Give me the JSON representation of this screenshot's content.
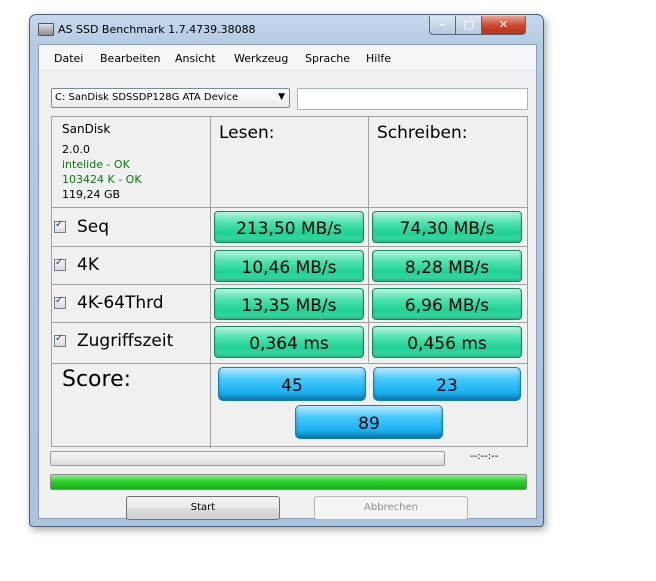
{
  "window": {
    "title": "AS SSD Benchmark 1.7.4739.38088"
  },
  "menu": [
    "Datei",
    "Bearbeiten",
    "Ansicht",
    "Werkzeug",
    "Sprache",
    "Hilfe"
  ],
  "drive": {
    "selected": "C: SanDisk SDSSDP128G ATA Device",
    "extra_field": ""
  },
  "info": {
    "vendor": "SanDisk",
    "firmware": "2.0.0",
    "driver": "intelide - OK",
    "alignment": "103424 K - OK",
    "size": "119,24 GB"
  },
  "columns": {
    "read": "Lesen:",
    "write": "Schreiben:"
  },
  "tests": [
    {
      "label": "Seq",
      "checked": true,
      "read": "213,50 MB/s",
      "write": "74,30 MB/s"
    },
    {
      "label": "4K",
      "checked": true,
      "read": "10,46 MB/s",
      "write": "8,28 MB/s"
    },
    {
      "label": "4K-64Thrd",
      "checked": true,
      "read": "13,35 MB/s",
      "write": "6,96 MB/s"
    },
    {
      "label": "Zugriffszeit",
      "checked": true,
      "read": "0,364 ms",
      "write": "0,456 ms"
    }
  ],
  "score": {
    "label": "Score:",
    "read": "45",
    "write": "23",
    "total": "89"
  },
  "status": {
    "time": "--:--:--",
    "progress_fraction": 1.0
  },
  "buttons": {
    "start": "Start",
    "cancel": "Abbrechen"
  },
  "colors": {
    "result_green": "#2fd89f",
    "score_blue": "#2bbcf4",
    "progress_green": "#29cc29"
  }
}
